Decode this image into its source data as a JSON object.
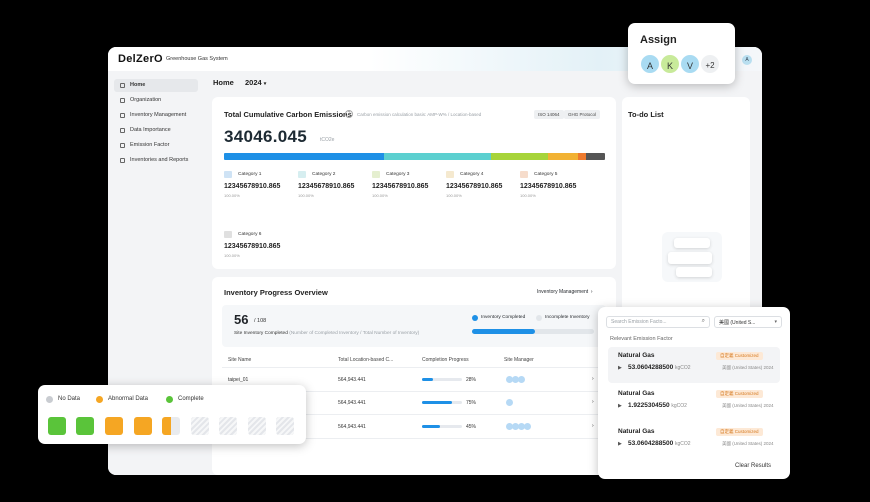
{
  "app": {
    "logo": "DelZerO",
    "subtitle": "Greenhouse Gas System",
    "user_initial": "A"
  },
  "sidebar": {
    "items": [
      {
        "label": "Home"
      },
      {
        "label": "Organization"
      },
      {
        "label": "Inventory Management"
      },
      {
        "label": "Data Importance"
      },
      {
        "label": "Emission Factor"
      },
      {
        "label": "Inventories and Reports"
      }
    ]
  },
  "header": {
    "breadcrumb": "Home",
    "year": "2024"
  },
  "emissions": {
    "title": "Total Cumulative Carbon Emissions",
    "basis": "Carbon emission calculation basis: AMP-W% / Location-based",
    "tag1": "ISO 14064",
    "tag2": "GHG Protocol",
    "total": "34046.045",
    "unit": "tCO2e",
    "bar_colors": [
      "#1e90e6",
      "#5cd0d0",
      "#a7d43a",
      "#f2b233",
      "#ee7a2e",
      "#555555"
    ],
    "bar_shares": [
      0.42,
      0.28,
      0.15,
      0.08,
      0.02,
      0.05
    ],
    "categories": [
      {
        "name": "Category 1",
        "value": "12345678910.865",
        "sub": "100.00%"
      },
      {
        "name": "Category 2",
        "value": "12345678910.865",
        "sub": "100.00%"
      },
      {
        "name": "Category 3",
        "value": "12345678910.865",
        "sub": "100.00%"
      },
      {
        "name": "Category 4",
        "value": "12345678910.865",
        "sub": "100.00%"
      },
      {
        "name": "Category 5",
        "value": "12345678910.865",
        "sub": "100.00%"
      },
      {
        "name": "Category 6",
        "value": "12345678910.865",
        "sub": "100.00%"
      }
    ]
  },
  "todo": {
    "title": "To-do List"
  },
  "progress": {
    "title": "Inventory Progress Overview",
    "link": "Inventory Management",
    "completed": "56",
    "total": "/ 108",
    "caption": "Site Inventory Completed",
    "caption_sub": "(Number of Completed Inventory / Total Number of Inventory)",
    "legend_completed": "Inventory Completed",
    "legend_incomplete": "Incomplete Inventory",
    "completion_ratio": 0.52,
    "columns": [
      "Site Name",
      "Total Location-based C...",
      "Completion Progress",
      "Site Manager"
    ],
    "rows": [
      {
        "site": "taipei_01",
        "total": "564,943.441",
        "pct": "28%",
        "ratio": 0.28
      },
      {
        "site": "",
        "total": "564,943.441",
        "pct": "75%",
        "ratio": 0.75
      },
      {
        "site": "",
        "total": "564,943.441",
        "pct": "45%",
        "ratio": 0.45
      }
    ]
  },
  "assign": {
    "title": "Assign",
    "avatars": [
      "A",
      "K",
      "V"
    ],
    "more": "+2"
  },
  "status_legend": {
    "no_data": "No Data",
    "abnormal": "Abnormal Data",
    "complete": "Complete"
  },
  "emission_factor": {
    "search_placeholder": "Search Emission Facto...",
    "region": "美國 (United S...",
    "heading": "Relevant Emission Factor",
    "items": [
      {
        "name": "Natural Gas",
        "value": "53.0604288500",
        "unit": "kgCO2",
        "source": "美國 (United States) 2024",
        "tag": "自定義 Customized"
      },
      {
        "name": "Natural Gas",
        "value": "1.9225304550",
        "unit": "kgCO2",
        "source": "美國 (United States) 2024",
        "tag": "自定義 Customized"
      },
      {
        "name": "Natural Gas",
        "value": "53.0604288500",
        "unit": "kgCO2",
        "source": "美國 (United States) 2024",
        "tag": "自定義 Customized"
      }
    ],
    "clear": "Clear Results"
  }
}
